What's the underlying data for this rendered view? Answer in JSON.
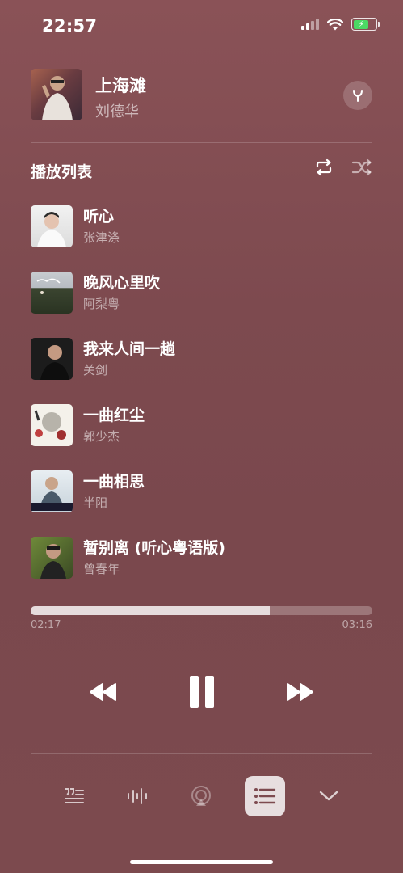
{
  "status_bar": {
    "time": "22:57",
    "icons": [
      "cellular-signal-icon",
      "wifi-icon",
      "battery-charging-icon"
    ]
  },
  "now_playing": {
    "title": "上海滩",
    "artist": "刘德华"
  },
  "queue": {
    "label": "播放列表",
    "tracks": [
      {
        "title": "听心",
        "artist": "张津涤"
      },
      {
        "title": "晚风心里吹",
        "artist": "阿梨粤"
      },
      {
        "title": "我来人间一趟",
        "artist": "关剑"
      },
      {
        "title": "一曲红尘",
        "artist": "郭少杰"
      },
      {
        "title": "一曲相思",
        "artist": "半阳"
      },
      {
        "title": "暂别离 (听心粤语版)",
        "artist": "曾春年"
      }
    ]
  },
  "playback": {
    "elapsed": "02:17",
    "total": "03:16",
    "progress_fraction": 0.7
  },
  "toolbar": {
    "items": [
      "lyrics-icon",
      "waveform-icon",
      "airplay-icon",
      "queue-list-icon",
      "chevron-down-icon"
    ],
    "active": "queue-list-icon"
  },
  "colors": {
    "background": "#7d4a4f",
    "battery": "#4cd964"
  }
}
